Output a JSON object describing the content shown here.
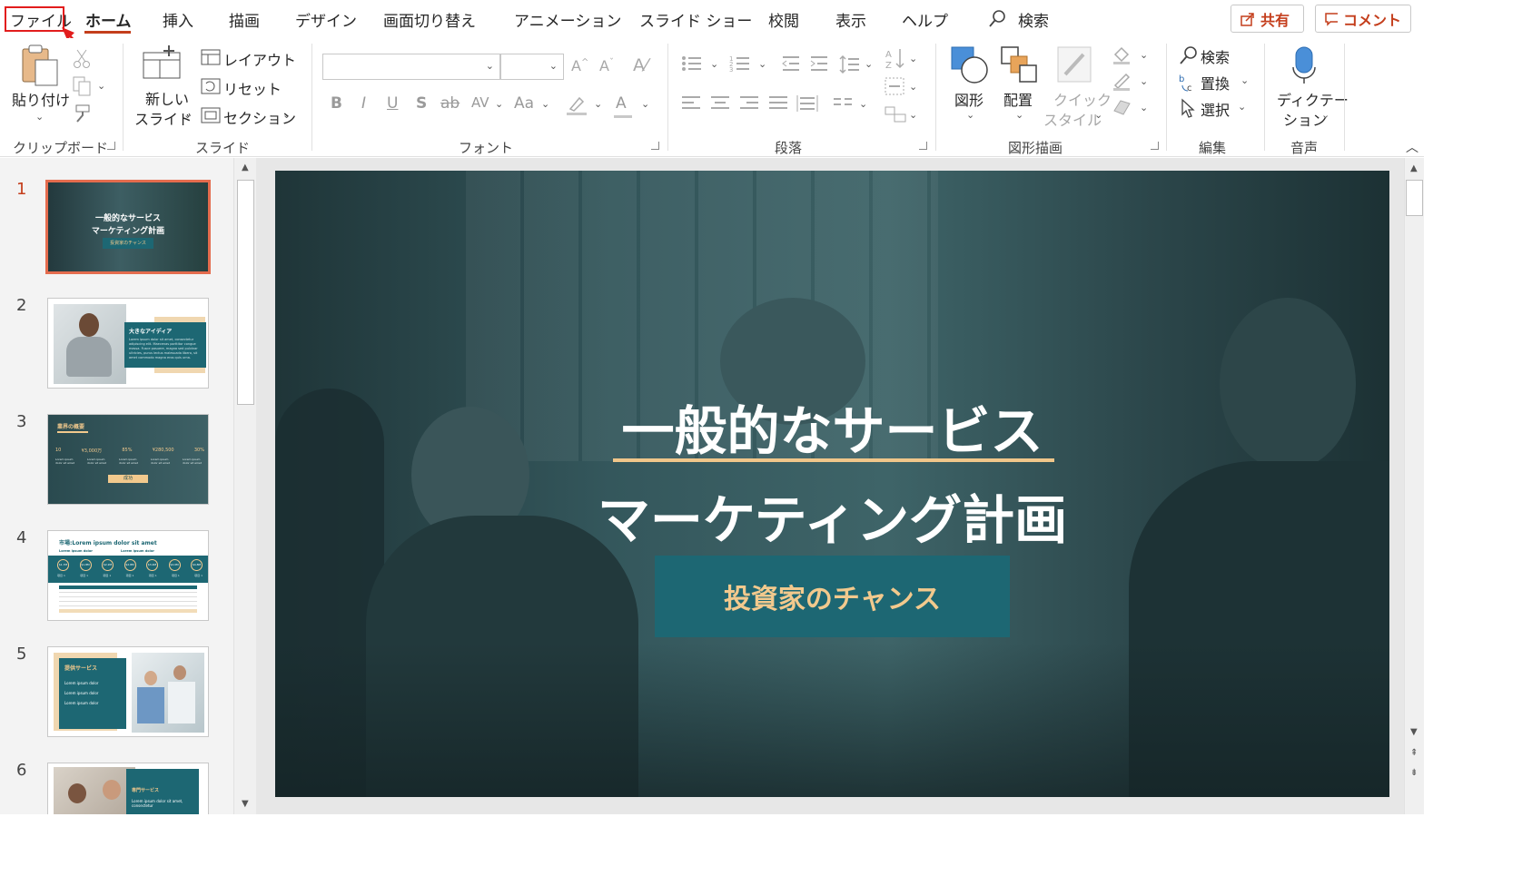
{
  "menu": {
    "tabs": [
      "ファイル",
      "ホーム",
      "挿入",
      "描画",
      "デザイン",
      "画面切り替え",
      "アニメーション",
      "スライド ショー",
      "校閲",
      "表示",
      "ヘルプ"
    ],
    "search_label": "検索",
    "share_label": "共有",
    "comment_label": "コメント"
  },
  "ribbon": {
    "clipboard": {
      "paste": "貼り付け",
      "label": "クリップボード"
    },
    "slides": {
      "new_slide_1": "新しい",
      "new_slide_2": "スライド",
      "layout": "レイアウト",
      "reset": "リセット",
      "section": "セクション",
      "label": "スライド"
    },
    "font": {
      "label": "フォント",
      "bold": "B",
      "italic": "I",
      "underline": "U",
      "shadow": "S",
      "strike": "ab",
      "case": "Aa",
      "color_a": "A"
    },
    "paragraph": {
      "label": "段落"
    },
    "drawing": {
      "shapes": "図形",
      "arrange": "配置",
      "quick_1": "クイック",
      "quick_2": "スタイル",
      "label": "図形描画"
    },
    "editing": {
      "find": "検索",
      "replace": "置換",
      "select": "選択",
      "label": "編集"
    },
    "voice": {
      "dictate_1": "ディクテー",
      "dictate_2": "ション",
      "label": "音声"
    }
  },
  "thumbnails": {
    "numbers": [
      "1",
      "2",
      "3",
      "4",
      "5",
      "6"
    ],
    "current": 1,
    "t1": {
      "title1": "一般的なサービス",
      "title2": "マーケティング計画",
      "sub": "投資家のチャンス"
    },
    "t2": {
      "title": "大きなアイディア",
      "body": "Lorem ipsum dolor sit amet, consectetur adipiscing elit. Maecenas porttitor congue massa. Fusce posuere, magna sed pulvinar ultricies, purus lectus malesuada libero, sit amet commodo magna eros quis urna."
    },
    "t3": {
      "title": "業界の概要",
      "stats": [
        "10",
        "¥3,000万",
        "85%",
        "¥280,500",
        "30%"
      ],
      "note": "Lorem ipsum dolor sit amet",
      "button": "成功"
    },
    "t4": {
      "title": "市場:Lorem ipsum dolor sit amet",
      "left": "Lorem ipsum dolor",
      "right": "Lorem ipsum dolor",
      "circles": [
        "$1.7M",
        "$1.8M",
        "$2.2M",
        "$2.8M",
        "$3.4M",
        "$4.0M",
        "$4.8M"
      ],
      "circle_label": "項目 1"
    },
    "t5": {
      "title": "提供サービス",
      "items": [
        "Lorem ipsum dolor",
        "Lorem ipsum dolor",
        "Lorem ipsum dolor"
      ]
    },
    "t6": {
      "title": "専門サービス",
      "body": "Lorem ipsum dolor sit amet, consectetur"
    }
  },
  "slide": {
    "title1": "一般的なサービス",
    "title2": "マーケティング計画",
    "button": "投資家のチャンス"
  },
  "colors": {
    "accent": "#c43e1c",
    "teal": "#1d6773",
    "gold": "#f2c98d",
    "highlight": "#e21d1d"
  }
}
